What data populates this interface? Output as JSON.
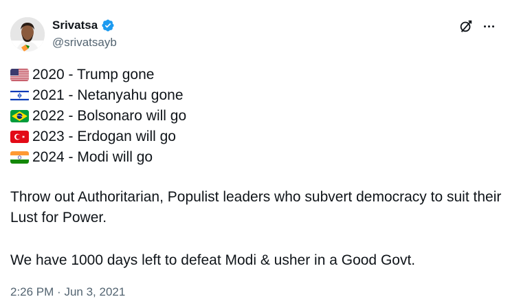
{
  "author": {
    "display_name": "Srivatsa",
    "handle": "@srivatsayb",
    "verified": true
  },
  "icons": {
    "avatar": "profile-photo",
    "verified": "verified-badge-icon",
    "grok": "grok-icon",
    "more": "more-icon"
  },
  "tweet": {
    "lines": [
      {
        "flag": "us-flag",
        "text": "2020 - Trump gone"
      },
      {
        "flag": "israel-flag",
        "text": "2021 - Netanyahu gone"
      },
      {
        "flag": "brazil-flag",
        "text": "2022 - Bolsonaro will go"
      },
      {
        "flag": "turkey-flag",
        "text": "2023 - Erdogan will go"
      },
      {
        "flag": "india-flag",
        "text": "2024 - Modi will go"
      }
    ],
    "paragraph1": "Throw out Authoritarian, Populist leaders who subvert democracy to suit their Lust for Power.",
    "paragraph2": "We have 1000 days left to defeat Modi & usher in a Good Govt.",
    "time": "2:26 PM",
    "separator": "·",
    "date": "Jun 3, 2021"
  },
  "colors": {
    "text": "#0f1419",
    "secondary": "#536471",
    "verified": "#1d9bf0"
  }
}
